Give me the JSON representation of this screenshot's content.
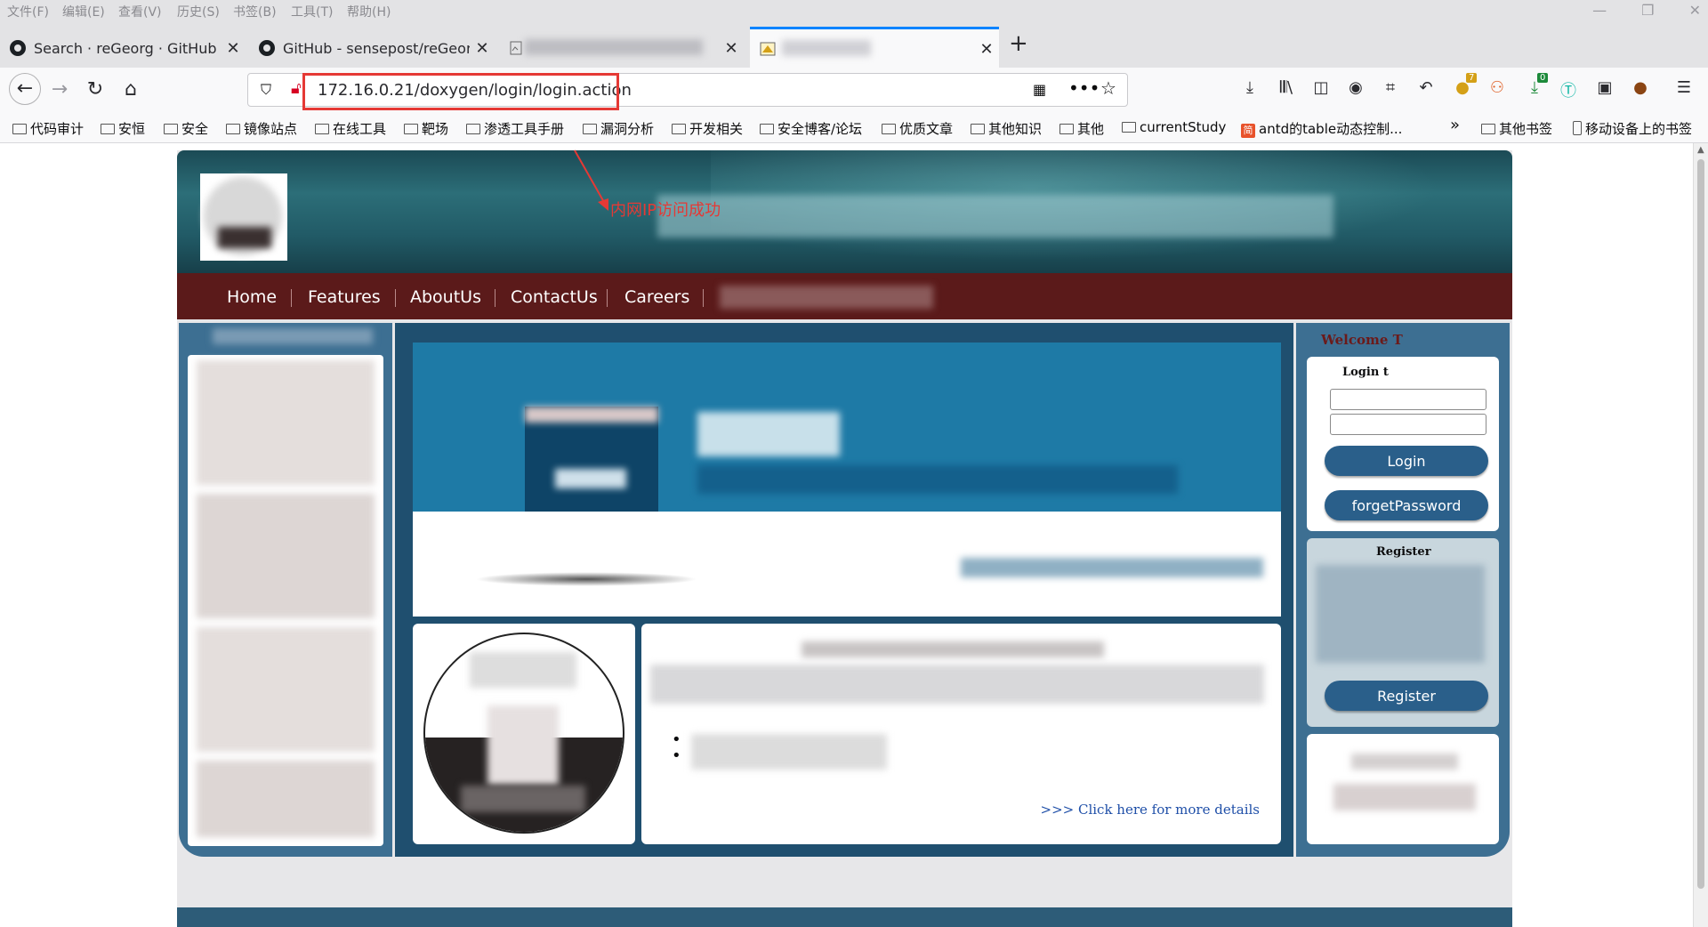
{
  "menubar": {
    "items": [
      "文件(F)",
      "编辑(E)",
      "查看(V)",
      "历史(S)",
      "书签(B)",
      "工具(T)",
      "帮助(H)"
    ]
  },
  "tabs": [
    {
      "title": "Search · reGeorg · GitHub",
      "icon": "github-icon"
    },
    {
      "title": "GitHub - sensepost/reGeorg",
      "icon": "github-icon"
    },
    {
      "title": "",
      "icon": "broken-image-icon"
    },
    {
      "title": "",
      "icon": "page-icon"
    }
  ],
  "new_tab_label": "+",
  "nav": {
    "url": "172.16.0.21/doxygen/login/login.action"
  },
  "toolbar_badges": {
    "extension_a": "7",
    "download": "0"
  },
  "bookmarks": [
    "代码审计",
    "安恒",
    "安全",
    "镜像站点",
    "在线工具",
    "靶场",
    "渗透工具手册",
    "漏洞分析",
    "开发相关",
    "安全博客/论坛",
    "优质文章",
    "其他知识",
    "其他",
    "currentStudy",
    "antd的table动态控制..."
  ],
  "bookmarks_right": [
    "其他书签",
    "移动设备上的书签"
  ],
  "annotation": "内网IP访问成功",
  "site": {
    "menu": [
      "Home",
      "Features",
      "AboutUs",
      "ContactUs",
      "Careers"
    ],
    "welcome": "Welcome T",
    "login_label": "Login t",
    "login_button": "Login",
    "forgot_button": "forgetPassword",
    "register_label": "Register",
    "register_button": "Register",
    "more_link": ">>> Click here for more details",
    "bullets": [
      "•",
      "•"
    ]
  },
  "colors": {
    "accent": "#0a84ff",
    "highlight_red": "#e53935",
    "site_menu": "#5b1a1a",
    "site_panel": "#3d6f92",
    "site_button": "#2a5f8a"
  }
}
